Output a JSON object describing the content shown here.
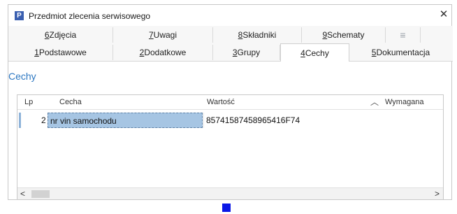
{
  "window": {
    "icon_letter": "P",
    "title": "Przedmiot zlecenia serwisowego",
    "close_glyph": "✕"
  },
  "tabs": {
    "row1": [
      {
        "key": "6",
        "label": "Zdjęcia"
      },
      {
        "key": "7",
        "label": "Uwagi"
      },
      {
        "key": "8",
        "label": "Składniki"
      },
      {
        "key": "9",
        "label": "Schematy"
      }
    ],
    "more_icon": "≡",
    "row2": [
      {
        "key": "1",
        "label": "Podstawowe"
      },
      {
        "key": "2",
        "label": "Dodatkowe"
      },
      {
        "key": "3",
        "label": "Grupy"
      },
      {
        "key": "4",
        "label": "Cechy",
        "active": true
      },
      {
        "key": "5",
        "label": "Dokumentacja"
      }
    ]
  },
  "section": {
    "title": "Cechy"
  },
  "grid": {
    "columns": {
      "lp": "Lp",
      "cecha": "Cecha",
      "wartosc": "Wartość",
      "wymagana": "Wymagana"
    },
    "sort_icon": "︿",
    "rows": [
      {
        "lp": "2",
        "cecha": "nr vin samochodu",
        "wartosc": "85741587458965416F74",
        "wymagana": ""
      }
    ],
    "scroll_left": "<",
    "scroll_right": ">"
  },
  "colors": {
    "accent": "#2e78c2",
    "selection": "#a6c5e3",
    "marker": "#0a17e6"
  }
}
